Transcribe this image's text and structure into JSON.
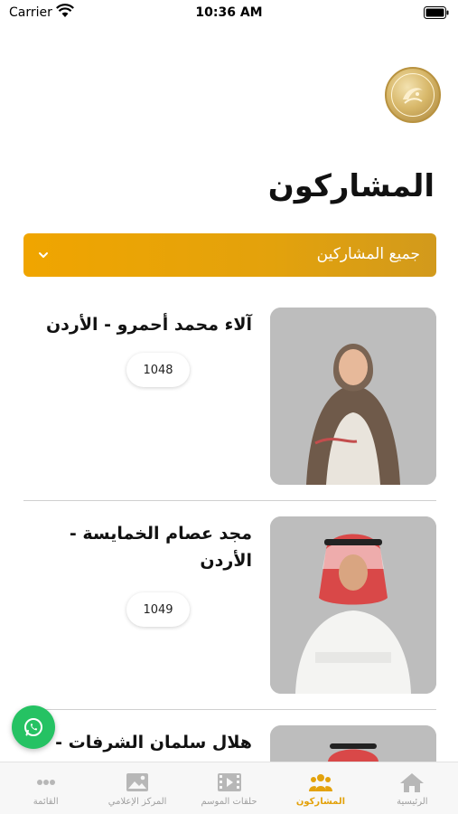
{
  "status_bar": {
    "carrier": "Carrier",
    "time": "10:36 AM"
  },
  "header": {
    "title": "المشاركون"
  },
  "filter": {
    "label": "جميع المشاركين"
  },
  "participants": [
    {
      "name": "آلاء محمد أحمرو - الأردن",
      "number": "1048"
    },
    {
      "name": "مجد عصام الخمايسة - الأردن",
      "number": "1049"
    },
    {
      "name": "هلال سلمان الشرفات -",
      "number": ""
    }
  ],
  "tabs": [
    {
      "label": "الرئيسية",
      "icon": "home-icon"
    },
    {
      "label": "المشاركون",
      "icon": "participants-icon"
    },
    {
      "label": "حلقات الموسم",
      "icon": "video-icon"
    },
    {
      "label": "المركز الإعلامي",
      "icon": "image-icon"
    },
    {
      "label": "القائمة",
      "icon": "more-icon"
    }
  ],
  "colors": {
    "accent": "#e3a20c",
    "whatsapp": "#25c263"
  }
}
